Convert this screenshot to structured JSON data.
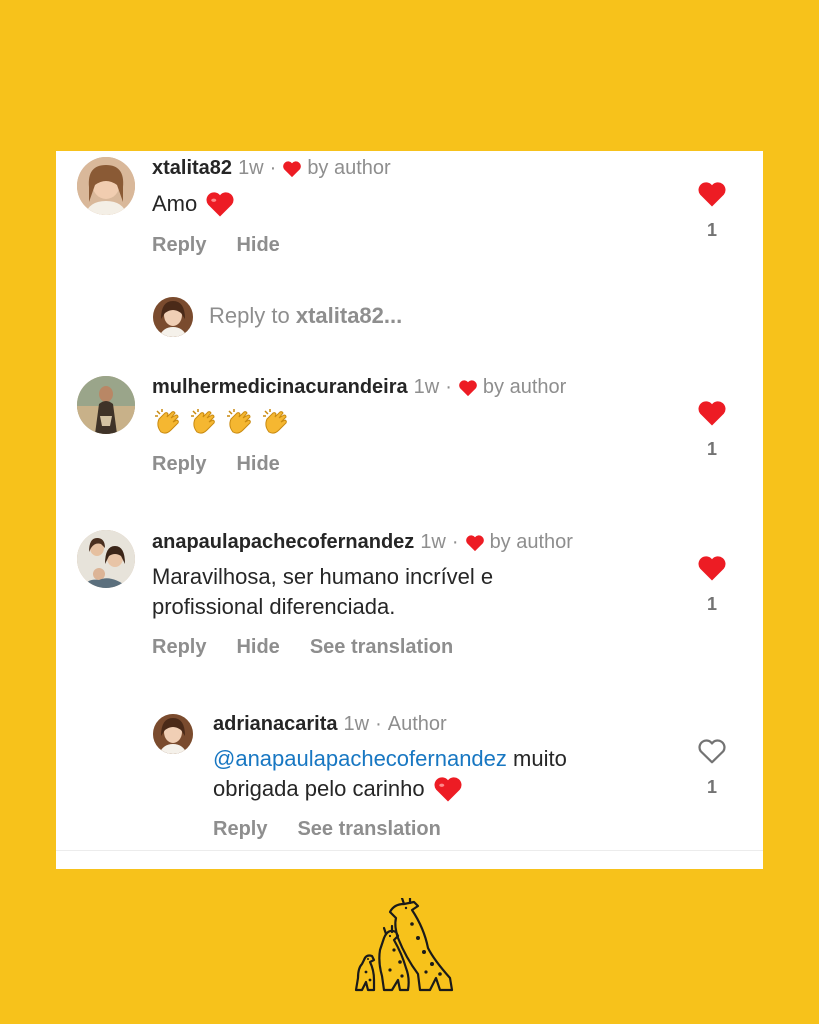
{
  "comments": [
    {
      "username": "xtalita82",
      "time": "1w",
      "liked_by": "by author",
      "text": "Amo",
      "text_emoji": "red-heart",
      "actions": [
        "Reply",
        "Hide"
      ],
      "likes": "1",
      "liked": true
    },
    {
      "username": "mulhermedicinacurandeira",
      "time": "1w",
      "liked_by": "by author",
      "text_emojis": [
        "clapping-hands",
        "clapping-hands",
        "clapping-hands",
        "clapping-hands"
      ],
      "actions": [
        "Reply",
        "Hide"
      ],
      "likes": "1",
      "liked": true
    },
    {
      "username": "anapaulapachecofernandez",
      "time": "1w",
      "liked_by": "by author",
      "text_line1": "Maravilhosa, ser humano incrível e",
      "text_line2": "profissional diferenciada.",
      "actions": [
        "Reply",
        "Hide",
        "See translation"
      ],
      "likes": "1",
      "liked": true
    }
  ],
  "reply_input": {
    "prefix": "Reply to",
    "target": "xtalita82..."
  },
  "author_reply": {
    "username": "adrianacarita",
    "time": "1w",
    "badge": "Author",
    "mention": "@anapaulapachecofernandez",
    "text_line1": "muito",
    "text_line2": "obrigada pelo carinho",
    "text_emoji": "red-heart",
    "actions": [
      "Reply",
      "See translation"
    ],
    "likes": "1",
    "liked": false
  },
  "colors": {
    "background": "#F7C21B",
    "like_red": "#ED1C24",
    "mention_blue": "#1877C2",
    "muted_gray": "#8E8E8E"
  },
  "logo": {
    "icon": "giraffe-logo-icon"
  }
}
